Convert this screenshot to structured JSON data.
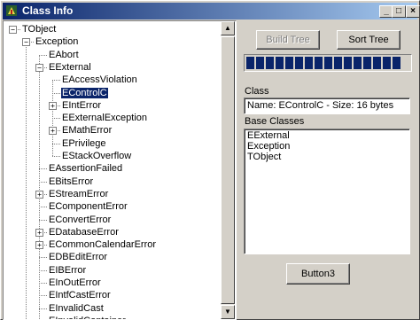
{
  "window": {
    "title": "Class Info",
    "min_label": "_",
    "max_label": "□",
    "close_label": "×"
  },
  "tree": {
    "items": [
      {
        "label": "TObject",
        "level": 0,
        "expander": "minus"
      },
      {
        "label": "Exception",
        "level": 1,
        "expander": "minus"
      },
      {
        "label": "EAbort",
        "level": 2,
        "expander": ""
      },
      {
        "label": "EExternal",
        "level": 2,
        "expander": "minus"
      },
      {
        "label": "EAccessViolation",
        "level": 3,
        "expander": ""
      },
      {
        "label": "EControlC",
        "level": 3,
        "expander": "",
        "selected": true
      },
      {
        "label": "EIntError",
        "level": 3,
        "expander": "plus"
      },
      {
        "label": "EExternalException",
        "level": 3,
        "expander": ""
      },
      {
        "label": "EMathError",
        "level": 3,
        "expander": "plus"
      },
      {
        "label": "EPrivilege",
        "level": 3,
        "expander": ""
      },
      {
        "label": "EStackOverflow",
        "level": 3,
        "expander": ""
      },
      {
        "label": "EAssertionFailed",
        "level": 2,
        "expander": ""
      },
      {
        "label": "EBitsError",
        "level": 2,
        "expander": ""
      },
      {
        "label": "EStreamError",
        "level": 2,
        "expander": "plus"
      },
      {
        "label": "EComponentError",
        "level": 2,
        "expander": ""
      },
      {
        "label": "EConvertError",
        "level": 2,
        "expander": ""
      },
      {
        "label": "EDatabaseError",
        "level": 2,
        "expander": "plus"
      },
      {
        "label": "ECommonCalendarError",
        "level": 2,
        "expander": "plus"
      },
      {
        "label": "EDBEditError",
        "level": 2,
        "expander": ""
      },
      {
        "label": "EIBError",
        "level": 2,
        "expander": ""
      },
      {
        "label": "EInOutError",
        "level": 2,
        "expander": ""
      },
      {
        "label": "EIntfCastError",
        "level": 2,
        "expander": ""
      },
      {
        "label": "EInvalidCast",
        "level": 2,
        "expander": ""
      },
      {
        "label": "EInvalidContainer",
        "level": 2,
        "expander": ""
      }
    ]
  },
  "buttons": {
    "build_tree": "Build Tree",
    "sort_tree": "Sort Tree",
    "button3": "Button3"
  },
  "progress": {
    "percent": 100,
    "fill_color": "#0a246a"
  },
  "class_section": {
    "label": "Class",
    "value": "Name: EControlC - Size: 16 bytes"
  },
  "base_classes": {
    "label": "Base Classes",
    "items": [
      "EExternal",
      "Exception",
      "TObject"
    ]
  },
  "colors": {
    "title_start": "#0a246a",
    "title_end": "#a6caf0",
    "selection": "#0a246a"
  }
}
